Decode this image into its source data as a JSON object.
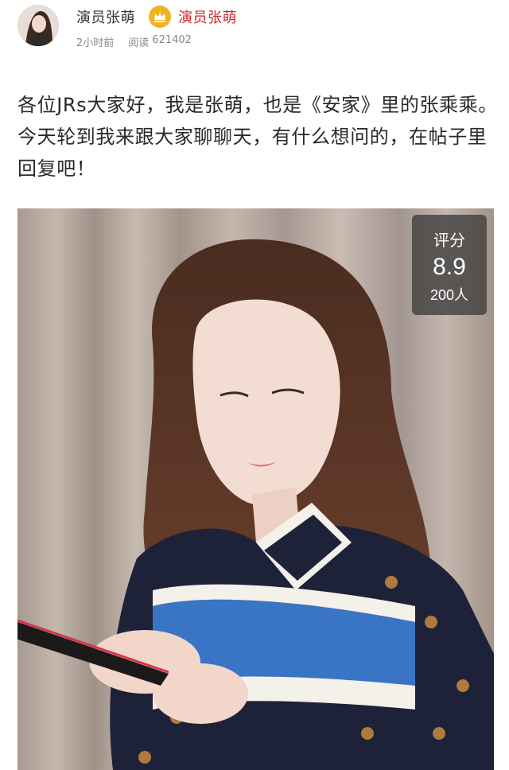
{
  "post": {
    "author": "演员张萌",
    "verified_name": "演员张萌",
    "time": "2小时前",
    "reads_label": "阅读",
    "reads_count": "621402",
    "content": "各位JRs大家好，我是张萌，也是《安家》里的张乘乘。今天轮到我来跟大家聊聊天，有什么想问的，在帖子里回复吧！"
  },
  "score": {
    "label": "评分",
    "value": "8.9",
    "count": "200人"
  },
  "colors": {
    "verified_red": "#d0282b",
    "badge_gold": "#f3b21d",
    "meta_gray": "#888888"
  },
  "icons": {
    "avatar": "profile-avatar",
    "badge": "crown-badge-icon"
  }
}
